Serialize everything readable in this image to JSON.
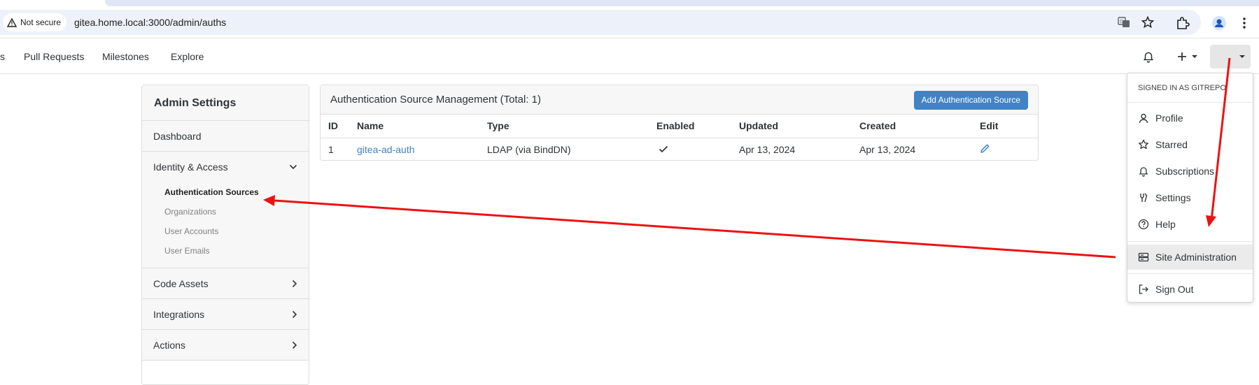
{
  "browser": {
    "security_chip": "Not secure",
    "url": "gitea.home.local:3000/admin/auths",
    "icons": [
      "warning-icon",
      "translate-icon",
      "star-icon",
      "extensions-icon",
      "profile-icon",
      "more-vert-icon"
    ]
  },
  "nav": {
    "cut_item": "s",
    "pull_requests": "Pull Requests",
    "milestones": "Milestones",
    "explore": "Explore",
    "icons": [
      "bell-icon",
      "plus-icon",
      "caret-down-icon"
    ]
  },
  "sidebar": {
    "title": "Admin Settings",
    "dashboard": "Dashboard",
    "identity_access": "Identity & Access",
    "sub_items": [
      "Authentication Sources",
      "Organizations",
      "User Accounts",
      "User Emails"
    ],
    "code_assets": "Code Assets",
    "integrations": "Integrations",
    "actions": "Actions"
  },
  "panel": {
    "title": "Authentication Source Management (Total: 1)",
    "add_button": "Add Authentication Source",
    "columns": [
      "ID",
      "Name",
      "Type",
      "Enabled",
      "Updated",
      "Created",
      "Edit"
    ],
    "rows": [
      {
        "id": "1",
        "name": "gitea-ad-auth",
        "type": "LDAP (via BindDN)",
        "enabled": true,
        "updated": "Apr 13, 2024",
        "created": "Apr 13, 2024"
      }
    ]
  },
  "dropdown": {
    "header": "SIGNED IN AS GITREPO",
    "items": [
      "Profile",
      "Starred",
      "Subscriptions",
      "Settings",
      "Help"
    ],
    "site_admin": "Site Administration",
    "sign_out": "Sign Out"
  },
  "colors": {
    "accent": "#4183c4",
    "annotation": "#ee1111"
  }
}
